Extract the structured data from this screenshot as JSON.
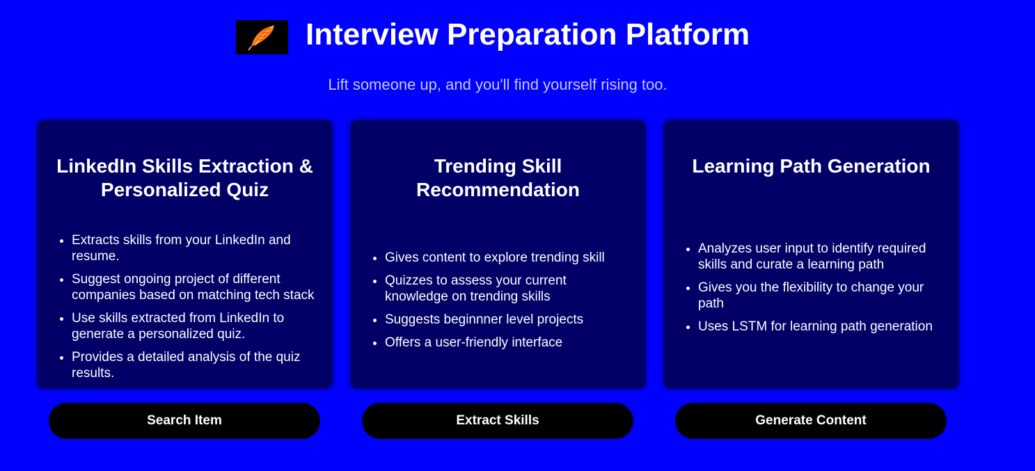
{
  "header": {
    "logo_icon": "feather-icon",
    "title": "Interview Preparation Platform",
    "tagline": "Lift someone up, and you'll find yourself rising too."
  },
  "colors": {
    "page_background": "#0000ff",
    "card_background": "#000066",
    "button_background": "#000000",
    "text": "#ffffff",
    "logo_feather": "#ff6a00"
  },
  "cards": [
    {
      "title": "LinkedIn Skills Extraction & Personalized Quiz",
      "items": [
        "Extracts skills from your LinkedIn and resume.",
        "Suggest ongoing project of different companies based on matching tech stack",
        "Use skills extracted from LinkedIn to generate a personalized quiz.",
        "Provides a detailed analysis of the quiz results."
      ],
      "button_label": "Search Item"
    },
    {
      "title": "Trending Skill Recommendation",
      "items": [
        "Gives content to explore trending skill",
        "Quizzes to assess your current knowledge on trending skills",
        "Suggests beginnner level projects",
        "Offers a user-friendly interface"
      ],
      "button_label": "Extract Skills"
    },
    {
      "title": "Learning Path Generation",
      "items": [
        "Analyzes user input to identify required skills and curate a learning path",
        "Gives you the flexibility to change your path",
        "Uses LSTM for learning path generation"
      ],
      "button_label": "Generate Content"
    }
  ]
}
